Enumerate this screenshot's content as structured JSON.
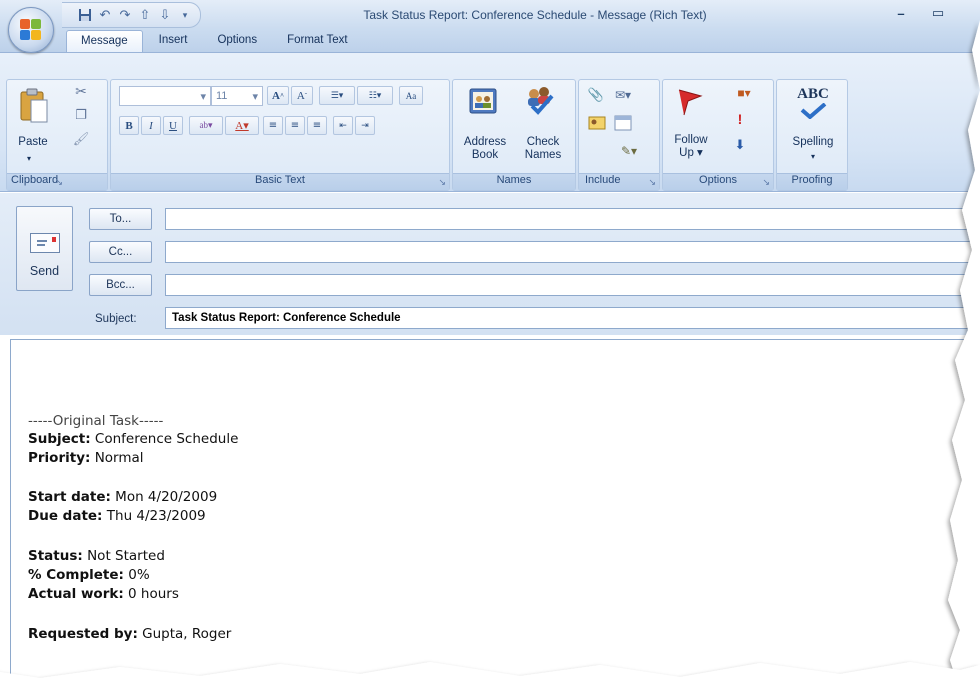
{
  "window": {
    "title": "Task Status Report: Conference Schedule - Message (Rich Text)",
    "minimize_icon": "minimize-icon",
    "maximize_icon": "maximize-icon"
  },
  "quick_access": {
    "icons": [
      "save-icon",
      "undo-icon",
      "redo-icon",
      "previous-item-icon",
      "next-item-icon",
      "customize-dropdown-icon"
    ]
  },
  "tabs": [
    {
      "label": "Message",
      "active": true
    },
    {
      "label": "Insert",
      "active": false
    },
    {
      "label": "Options",
      "active": false
    },
    {
      "label": "Format Text",
      "active": false
    }
  ],
  "ribbon": {
    "clipboard": {
      "label": "Clipboard",
      "paste": "Paste"
    },
    "basic_text": {
      "label": "Basic Text",
      "font_size": "11"
    },
    "names": {
      "label": "Names",
      "address_book_1": "Address",
      "address_book_2": "Book",
      "check_names_1": "Check",
      "check_names_2": "Names"
    },
    "include": {
      "label": "Include"
    },
    "options": {
      "label": "Options",
      "follow_up_1": "Follow",
      "follow_up_2": "Up ▾"
    },
    "proofing": {
      "label": "Proofing",
      "spelling": "Spelling",
      "abc": "ABC"
    }
  },
  "header": {
    "send_label": "Send",
    "to_label": "To...",
    "cc_label": "Cc...",
    "bcc_label": "Bcc...",
    "subject_label": "Subject:",
    "subject_value": "Task Status Report: Conference Schedule"
  },
  "body": {
    "original_task": "-----Original Task-----",
    "subject_label": "Subject:",
    "subject_value": " Conference Schedule",
    "priority_label": "Priority:",
    "priority_value": " Normal",
    "start_label": "Start date:",
    "start_value": " Mon 4/20/2009",
    "due_label": "Due date:",
    "due_value": " Thu 4/23/2009",
    "status_label": "Status:",
    "status_value": " Not Started",
    "complete_label": "% Complete:",
    "complete_value": " 0%",
    "work_label": "Actual work:",
    "work_value": " 0 hours",
    "requested_label": "Requested by:",
    "requested_value": " Gupta, Roger"
  }
}
